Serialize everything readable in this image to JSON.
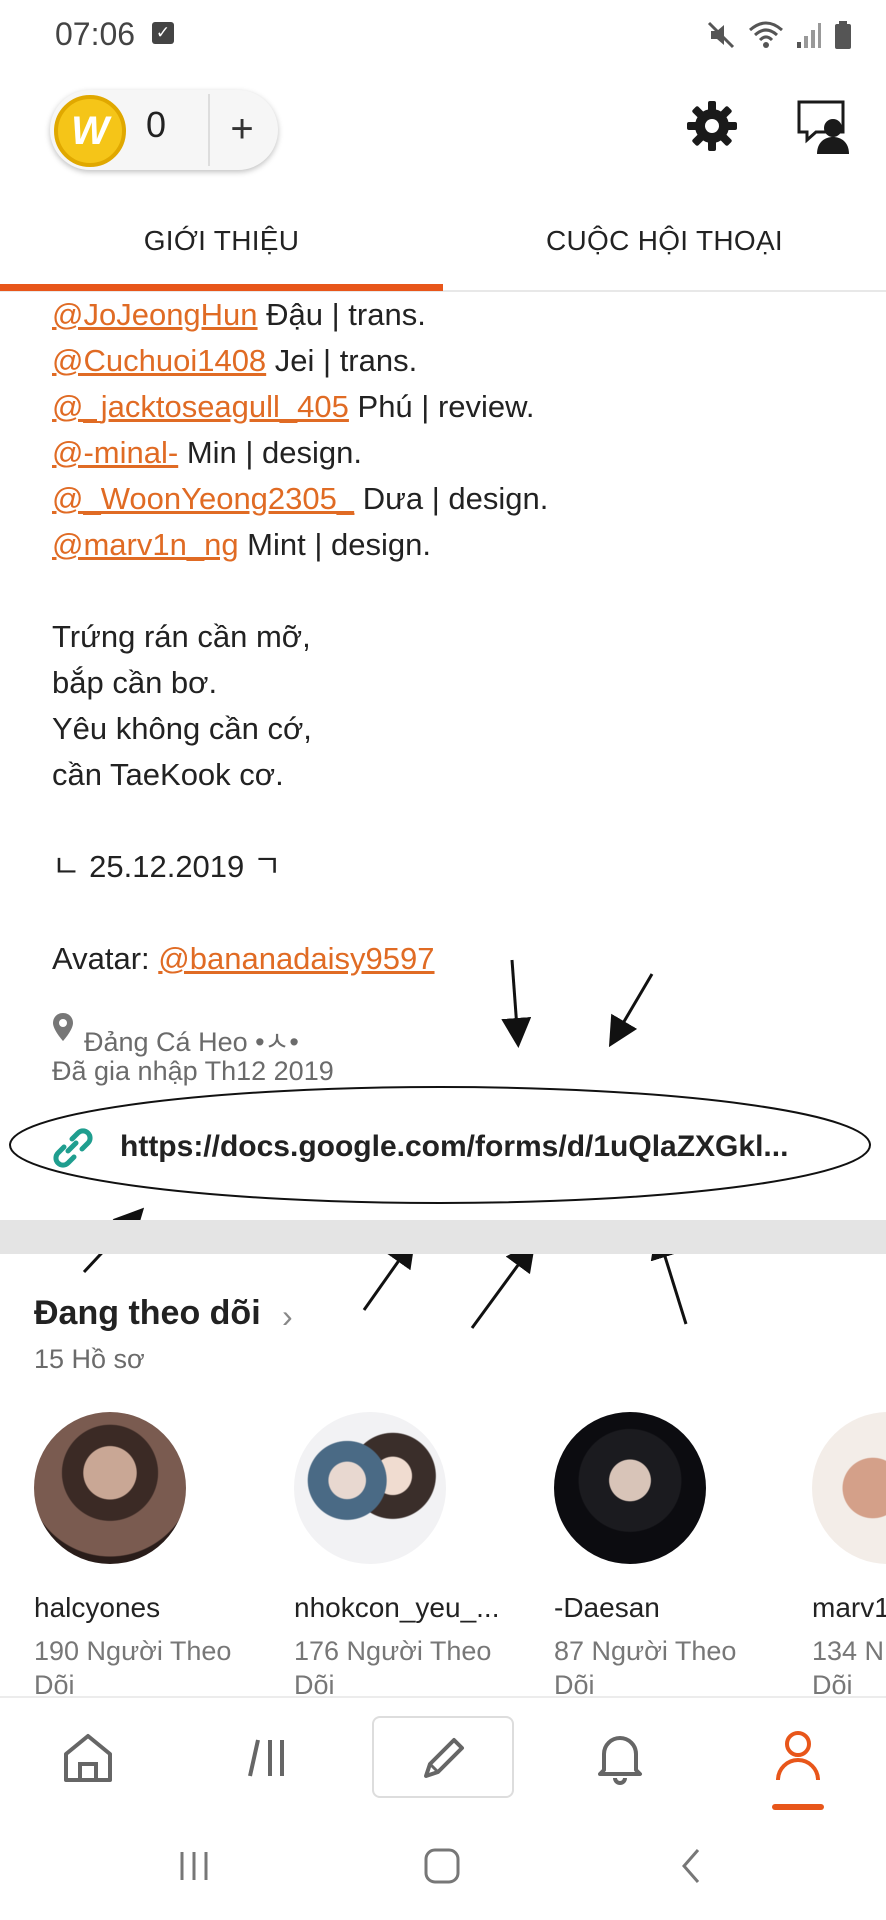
{
  "status_bar": {
    "time": "07:06"
  },
  "header": {
    "coin_count": "0",
    "plus_label": "+"
  },
  "tabs": [
    {
      "label": "GIỚI THIỆU",
      "active": true
    },
    {
      "label": "CUỘC HỘI THOẠI",
      "active": false
    }
  ],
  "bio": {
    "credits": [
      {
        "handle": "@JoJeongHun",
        "text": " Đậu | trans."
      },
      {
        "handle": "@Cuchuoi1408",
        "text": " Jei | trans."
      },
      {
        "handle": "@_jacktoseagull_405",
        "text": " Phú | review."
      },
      {
        "handle": "@-minal-",
        "text": " Min | design."
      },
      {
        "handle": "@_WoonYeong2305_",
        "text": " Dưa | design."
      },
      {
        "handle": "@marv1n_ng",
        "text": " Mint | design."
      }
    ],
    "poem": [
      "Trứng rán cần mỡ,",
      "bắp cần bơ.",
      "Yêu không cần cớ,",
      "cần TaeKook cơ."
    ],
    "date_line": "ㄴ 25.12.2019 ㄱ",
    "avatar_prefix": "Avatar: ",
    "avatar_handle": "@bananadaisy9597"
  },
  "location": "Đảng Cá Heo •ㅅ•",
  "joined": "Đã gia nhập Th12 2019",
  "link": "https://docs.google.com/forms/d/1uQlaZXGkl...",
  "following": {
    "title": "Đang theo dõi",
    "count": "15 Hồ sơ",
    "profiles": [
      {
        "name": "halcyones",
        "followers_1": "190 Người Theo",
        "followers_2": "Dõi"
      },
      {
        "name": "nhokcon_yeu_...",
        "followers_1": "176 Người Theo",
        "followers_2": "Dõi"
      },
      {
        "name": "-Daesan",
        "followers_1": "87 Người Theo",
        "followers_2": "Dõi"
      },
      {
        "name": "marv1",
        "followers_1": "134 N",
        "followers_2": "Dõi"
      }
    ]
  },
  "colors": {
    "accent": "#e8561a",
    "link": "#e06b24",
    "link_icon": "#1f9e8f"
  }
}
